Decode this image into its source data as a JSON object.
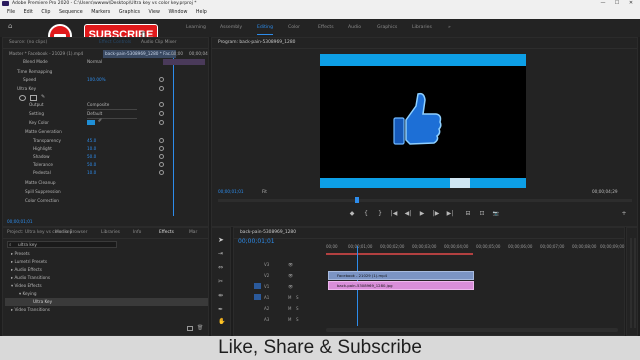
{
  "window": {
    "title": "Adobe Premiere Pro 2020 - C:\\Users\\wwww\\Desktop\\Ultra key vs color key.prproj *",
    "minimize": "—",
    "maximize": "☐",
    "close": "✕"
  },
  "menu": [
    "File",
    "Edit",
    "Clip",
    "Sequence",
    "Markers",
    "Graphics",
    "View",
    "Window",
    "Help"
  ],
  "workspaces": {
    "home": "⌂",
    "items": [
      "Learning",
      "Assembly",
      "Editing",
      "Color",
      "Effects",
      "Audio",
      "Graphics",
      "Libraries"
    ],
    "active": "Editing",
    "more": "»"
  },
  "overlay": {
    "subscribe": "SUBSCRIBE",
    "colors": {
      "red": "#e0191b"
    }
  },
  "effect_controls": {
    "tabs": [
      "Source: (no clips)",
      "Effect Controls",
      "Audio Clip Mixer",
      "Metadata"
    ],
    "master": "Master * Facebook - 21029 (1).mp4",
    "clip": "back-pain-5308969_1280 * Fac...",
    "timecode_start": "00;00",
    "timecode_end": "00;00;04",
    "rows": [
      {
        "label": "Blend Mode",
        "value": "Normal"
      },
      {
        "label": "Time Remapping",
        "value": ""
      },
      {
        "label": "Speed",
        "value": "100.00%"
      },
      {
        "label": "Ultra Key",
        "value": ""
      },
      {
        "label": "Output",
        "value": "Composite"
      },
      {
        "label": "Setting",
        "value": "Default"
      },
      {
        "label": "Key Color",
        "value": ""
      },
      {
        "label": "Matte Generation",
        "value": ""
      },
      {
        "label": "Transparency",
        "value": "45.0"
      },
      {
        "label": "Highlight",
        "value": "10.0"
      },
      {
        "label": "Shadow",
        "value": "50.0"
      },
      {
        "label": "Tolerance",
        "value": "50.0"
      },
      {
        "label": "Pedestal",
        "value": "10.0"
      },
      {
        "label": "Matte Cleanup",
        "value": ""
      },
      {
        "label": "Spill Suppression",
        "value": ""
      },
      {
        "label": "Color Correction",
        "value": ""
      }
    ],
    "footer_time": "00;00;01;01"
  },
  "program": {
    "title": "Program: back-pain-5308969_1280",
    "timecode_left": "00;00;01;01",
    "fit": "Fit",
    "timecode_right": "00;00;04;29",
    "ctrl": [
      "◆",
      "{",
      "}",
      "|◀",
      "◀|",
      "▶",
      "|▶",
      "▶|",
      "⊟",
      "⊡",
      "📷",
      "+"
    ],
    "colors": {
      "bar": "#0d9fe6",
      "screen": "#000000",
      "icon": "#1d6fd6"
    }
  },
  "project": {
    "tabs": [
      "Project: Ultra key vs color key",
      "Media Browser",
      "Libraries",
      "Info",
      "Effects",
      "Mar"
    ],
    "search": "ultra key",
    "tree": [
      {
        "label": "Presets",
        "level": 0
      },
      {
        "label": "Lumetri Presets",
        "level": 0
      },
      {
        "label": "Audio Effects",
        "level": 0
      },
      {
        "label": "Audio Transitions",
        "level": 0
      },
      {
        "label": "Video Effects",
        "level": 0
      },
      {
        "label": "Keying",
        "level": 1
      },
      {
        "label": "Ultra Key",
        "level": 2
      },
      {
        "label": "Video Transitions",
        "level": 0
      }
    ]
  },
  "timeline": {
    "title": "back-pain-5308969_1280",
    "timecode": "00;00;01;01",
    "ruler": [
      "00;00",
      "00;00;01;00",
      "00;00;02;00",
      "00;00;03;00",
      "00;00;04;00",
      "00;00;05;00",
      "00;00;06;00",
      "00;00;07;00",
      "00;00;08;00",
      "00;00;09;00"
    ],
    "tracks": [
      "V3",
      "V2",
      "V1",
      "A1",
      "A2",
      "A3"
    ],
    "clips": [
      {
        "name": "Facebook - 21029 (1).mp4",
        "color": "#7b94c4"
      },
      {
        "name": "back-pain-5308969_1280.jpg",
        "color": "#d98ed9"
      }
    ]
  },
  "caption": "Like, Share & Subscribe"
}
